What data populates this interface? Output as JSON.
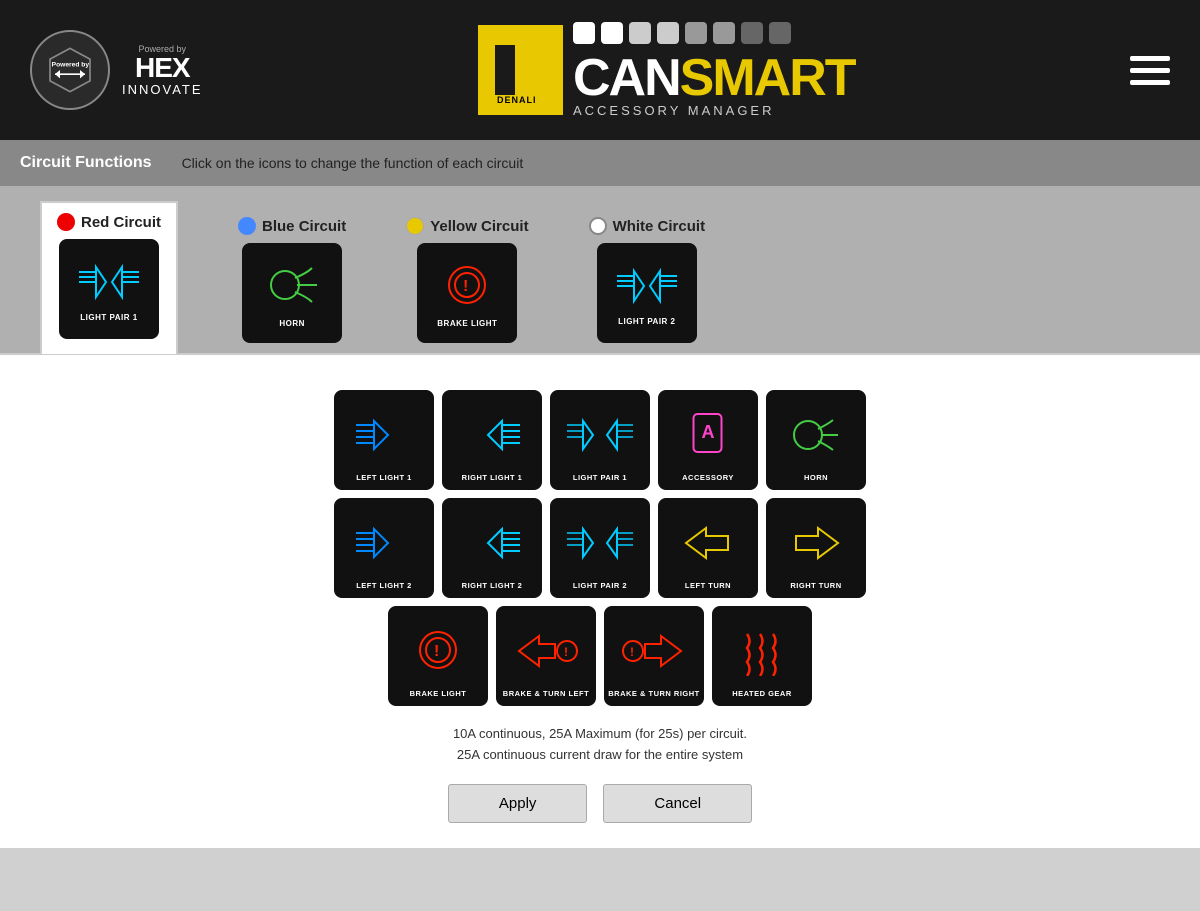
{
  "header": {
    "powered_by": "Powered by",
    "hex": "HEX",
    "innovate": "INNOVATE",
    "can": "CAN",
    "smart": "SMART",
    "accessory_manager": "ACCESSORY MANAGER",
    "denali": "DENALI"
  },
  "circuit_bar": {
    "title": "Circuit Functions",
    "description": "Click on the icons to change the function of each circuit"
  },
  "circuits": [
    {
      "id": "red",
      "label": "Red Circuit",
      "dot": "red",
      "active": true,
      "function_label": "LIGHT PAIR 1"
    },
    {
      "id": "blue",
      "label": "Blue Circuit",
      "dot": "blue",
      "active": false,
      "function_label": "HORN"
    },
    {
      "id": "yellow",
      "label": "Yellow Circuit",
      "dot": "yellow",
      "active": false,
      "function_label": "BRAKE LIGHT"
    },
    {
      "id": "white",
      "label": "White Circuit",
      "dot": "white",
      "active": false,
      "function_label": "LIGHT PAIR 2"
    }
  ],
  "icon_rows": [
    [
      {
        "label": "LEFT LIGHT 1",
        "color": "#00aaff",
        "type": "left-light"
      },
      {
        "label": "RIGHT LIGHT 1",
        "color": "#00ccff",
        "type": "right-light"
      },
      {
        "label": "LIGHT PAIR 1",
        "color": "#00ccff",
        "type": "light-pair"
      },
      {
        "label": "ACCESSORY",
        "color": "#ff44cc",
        "type": "accessory"
      },
      {
        "label": "HORN",
        "color": "#44cc44",
        "type": "horn"
      }
    ],
    [
      {
        "label": "LEFT LIGHT 2",
        "color": "#00aaff",
        "type": "left-light2"
      },
      {
        "label": "RIGHT LIGHT 2",
        "color": "#00ccff",
        "type": "right-light2"
      },
      {
        "label": "LIGHT PAIR 2",
        "color": "#00ccff",
        "type": "light-pair2"
      },
      {
        "label": "LEFT TURN",
        "color": "#e8c800",
        "type": "left-turn"
      },
      {
        "label": "RIGHT TURN",
        "color": "#e8c800",
        "type": "right-turn"
      }
    ],
    [
      {
        "label": "BRAKE LIGHT",
        "color": "#ff2200",
        "type": "brake"
      },
      {
        "label": "BRAKE & TURN LEFT",
        "color": "#ff2200",
        "type": "brake-turn-left"
      },
      {
        "label": "BRAKE & TURN RIGHT",
        "color": "#ff2200",
        "type": "brake-turn-right"
      },
      {
        "label": "HEATED GEAR",
        "color": "#ff2200",
        "type": "heated-gear"
      }
    ]
  ],
  "info": {
    "line1": "10A continuous, 25A Maximum (for 25s) per circuit.",
    "line2": "25A continuous current draw for the entire system"
  },
  "buttons": {
    "apply": "Apply",
    "cancel": "Cancel"
  }
}
